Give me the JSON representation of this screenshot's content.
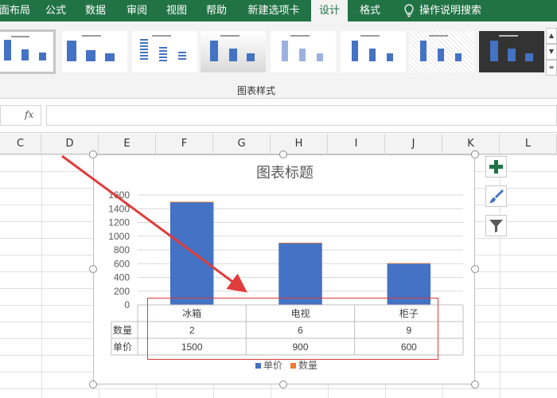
{
  "ribbon": {
    "tabs": [
      {
        "label": "页面布局"
      },
      {
        "label": "公式"
      },
      {
        "label": "数据"
      },
      {
        "label": "审阅"
      },
      {
        "label": "视图"
      },
      {
        "label": "帮助"
      },
      {
        "label": "新建选项卡"
      },
      {
        "label": "设计"
      },
      {
        "label": "格式"
      }
    ],
    "tell_me": "操作说明搜索",
    "active_tab": "设计",
    "group_label": "图表样式",
    "style_count": 8,
    "selected_style": 1
  },
  "formula_bar": {
    "fx_label": "fx",
    "value": ""
  },
  "columns": [
    "C",
    "D",
    "E",
    "F",
    "G",
    "H",
    "I",
    "J",
    "K",
    "L"
  ],
  "chart": {
    "title": "图表标题",
    "chart_data": {
      "type": "bar",
      "title": "图表标题",
      "categories": [
        "冰箱",
        "电视",
        "柜子"
      ],
      "series": [
        {
          "name": "单价",
          "values": [
            1500,
            900,
            600
          ],
          "color": "#4472c4"
        },
        {
          "name": "数量",
          "values": [
            2,
            6,
            9
          ],
          "color": "#ed7d31"
        }
      ],
      "stacked": true,
      "ylim": [
        0,
        1600
      ],
      "yticks": [
        0,
        200,
        400,
        600,
        800,
        1000,
        1200,
        1400,
        1600
      ],
      "grid": true,
      "legend": "bottom",
      "data_table": true
    },
    "side_buttons": [
      {
        "name": "chart-elements-button",
        "icon": "plus-icon"
      },
      {
        "name": "chart-styles-button",
        "icon": "brush-icon"
      },
      {
        "name": "chart-filters-button",
        "icon": "filter-icon"
      }
    ]
  },
  "annotation": {
    "arrow_color": "#e03c3c",
    "box_color": "#e03c3c"
  }
}
